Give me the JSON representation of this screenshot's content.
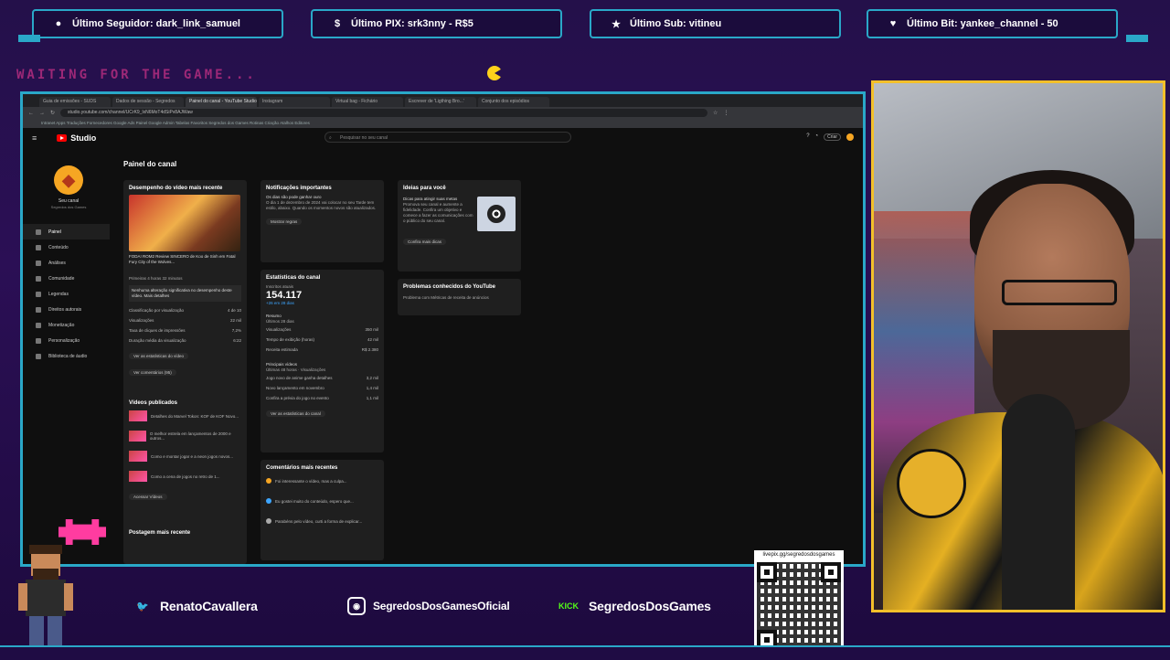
{
  "overlay": {
    "alerts": [
      {
        "label": "Último Seguidor: dark_link_samuel",
        "icon": "person-icon"
      },
      {
        "label": "Último PIX: srk3nny - R$5",
        "icon": "dollar-icon"
      },
      {
        "label": "Último Sub: vitineu",
        "icon": "star-icon"
      },
      {
        "label": "Último Bit: yankee_channel - 50",
        "icon": "heart-icon"
      }
    ],
    "waiting_text": "WAITING FOR THE GAME...",
    "socials": [
      {
        "label": "RenatoCavallera",
        "icon": "twitter-icon",
        "color": "#1d9bf0"
      },
      {
        "label": "SegredosDosGamesOficial",
        "icon": "instagram-icon",
        "color": "#e1306c"
      },
      {
        "label": "SegredosDosGames",
        "icon": "kick-icon",
        "icon_text": "KICK",
        "color": "#53fc18"
      }
    ],
    "qr_url": "livepix.gg/segredosdosgames",
    "accent_color": "#2aa8c8",
    "cam_border_color": "#f3c02a"
  },
  "browser": {
    "tabs": [
      "Guia de emissões - SUDS",
      "Dados de sessão - Segredos",
      "Painel do canal - YouTube Studio",
      "Instagram",
      "Virtual bag - Fichário",
      "Escrever de 'Ligthing Bro...'",
      "Conjunto dos episódios"
    ],
    "url": "studio.youtube.com/channel/UCrK9_lxN6MoT4dSiPv8AJWaw",
    "bookmarks": "Intranet  Apps  Traduções  Fornecedores  Google Ads  Painel  Google Admin  Tabelas  Favoritos  Segredos dos Games  Rotinas  Criação  Atalhos  Editores",
    "studio_label": "Studio",
    "search_placeholder": "Pesquisar no seu canal",
    "create_label": "Criar"
  },
  "studio": {
    "channel_name": "Seu canal",
    "channel_sub": "Segredos dos Games",
    "nav": [
      "Painel",
      "Conteúdo",
      "Análises",
      "Comunidade",
      "Legendas",
      "Direitos autorais",
      "Monetização",
      "Personalização",
      "Biblioteca de áudio"
    ],
    "page_title": "Painel do canal",
    "latest": {
      "title": "Desempenho do vídeo mais recente",
      "video_title": "FODA! ROM2 Review SINCERO de Koo de Sinh em Fatal Fury City of the Wolves...",
      "time_note": "Primeiras 4 horas 32 minutos",
      "tip": "Nenhuma alteração significativa no desempenho deste vídeo. Mais detalhes",
      "rows": [
        {
          "label": "Classificação por visualização",
          "value": "4 de 10"
        },
        {
          "label": "Visualizações",
          "value": "22 mil"
        },
        {
          "label": "Taxa de cliques de impressões",
          "value": "7,2%"
        },
        {
          "label": "Duração média da visualização",
          "value": "6:22"
        }
      ],
      "link1": "Ver as estatísticas do vídeo",
      "link2": "Ver comentários (95)"
    },
    "published": {
      "title": "Vídeos publicados",
      "items": [
        "Detalhes do Marvel Tokon: KOF de KOF Novo...",
        "O melhor estrela em lançamentos de 2000 e outros...",
        "Como e montar jogar e a neon jogos novos...",
        "Como a cena de jogos no retro de 1..."
      ],
      "link": "Acessar Vídeos"
    },
    "latest_post_title": "Postagem mais recente",
    "notifications": {
      "title": "Notificações importantes",
      "heading": "Os dias são pode ganhar ouro",
      "body": "O dia 1 de dezembro de 2024 vai colocar no seu Tarde tem estilo, abaixo. Quando os momentos novos são atualizados.",
      "link": "Mostrar regras"
    },
    "stats": {
      "title": "Estatísticas do canal",
      "subs_label": "Inscritos atuais",
      "subs_value": "154.117",
      "subs_delta": "+26 em 28 dias",
      "summary_title": "Resumo",
      "summary_sub": "Últimos 28 dias",
      "rows": [
        {
          "label": "Visualizações",
          "value": "350 mil"
        },
        {
          "label": "Tempo de exibição (horas)",
          "value": "42 mil"
        },
        {
          "label": "Receita estimada",
          "value": "R$ 2.380"
        }
      ],
      "top_title": "Principais vídeos",
      "top_sub": "Últimas 48 horas · Visualizações",
      "top_items": [
        {
          "label": "Jogo novo de anime ganha detalhes",
          "value": "3,2 mil"
        },
        {
          "label": "Novo lançamento em novembro",
          "value": "1,4 mil"
        },
        {
          "label": "Confira a prévia do jogo no evento",
          "value": "1,1 mil"
        }
      ],
      "link": "Ver as estatísticas do canal"
    },
    "comments": {
      "title": "Comentários mais recentes",
      "items": [
        "Foi interessante o vídeo, mas a culpa...",
        "Eu gostei muito do conteúdo, espero que...",
        "Parabéns pelo vídeo, curti a forma de explicar..."
      ]
    },
    "ideas": {
      "title": "Ideias para você",
      "heading": "Dicas para atingir suas metas",
      "body": "Promova seu canal e aumente a fidelidade. Confira um objetivo e comece a fazer as comunicações com o público do seu canal.",
      "link": "Confira mais dicas"
    },
    "known_issues": {
      "title": "Problemas conhecidos do YouTube",
      "item": "Problema com Métricas de receita de anúncios"
    }
  }
}
